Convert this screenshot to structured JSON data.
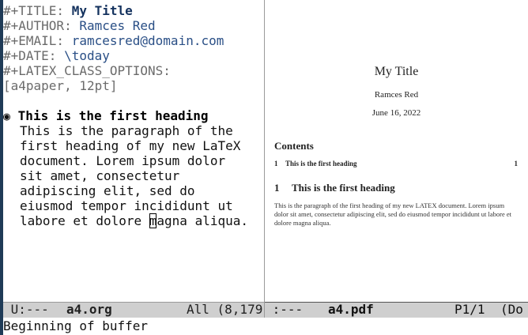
{
  "org": {
    "title_key": "#+TITLE: ",
    "title_val": "My Title",
    "author_key": "#+AUTHOR: ",
    "author_val": "Ramces Red",
    "email_key": "#+EMAIL: ",
    "email_val": "ramcesred@domain.com",
    "date_key": "#+DATE: ",
    "date_val": "\\today",
    "latex_key": "#+LATEX_CLASS_OPTIONS:",
    "latex_val": "[a4paper, 12pt]",
    "bullet": "◉",
    "heading": "This is the first heading",
    "para": [
      "This is the paragraph of the",
      "first heading of my new LaTeX",
      "document. Lorem ipsum dolor",
      "sit amet, consectetur",
      "adipiscing elit, sed do",
      "eiusmod tempor incididunt ut"
    ],
    "last_before": "labore et dolore ",
    "cursor_char": "m",
    "last_after": "agna aliqua."
  },
  "pdf": {
    "title": "My Title",
    "author": "Ramces Red",
    "date": "June 16, 2022",
    "contents_heading": "Contents",
    "toc_num": "1",
    "toc_text": "This is the first heading",
    "toc_page": "1",
    "section_num": "1",
    "section_title": "This is the first heading",
    "body": "This is the paragraph of the first heading of my new LATEX document. Lorem ipsum dolor sit amet, consectetur adipiscing elit, sed do eiusmod tempor incididunt ut labore et dolore magna aliqua."
  },
  "modeline_left": {
    "status": " U:---  ",
    "buffer": "a4.org",
    "position": "All (8,179"
  },
  "modeline_right": {
    "status": " :---  ",
    "buffer": "a4.pdf",
    "page": "P1/1",
    "mode": "(Do"
  },
  "echo_area": "Beginning of buffer"
}
